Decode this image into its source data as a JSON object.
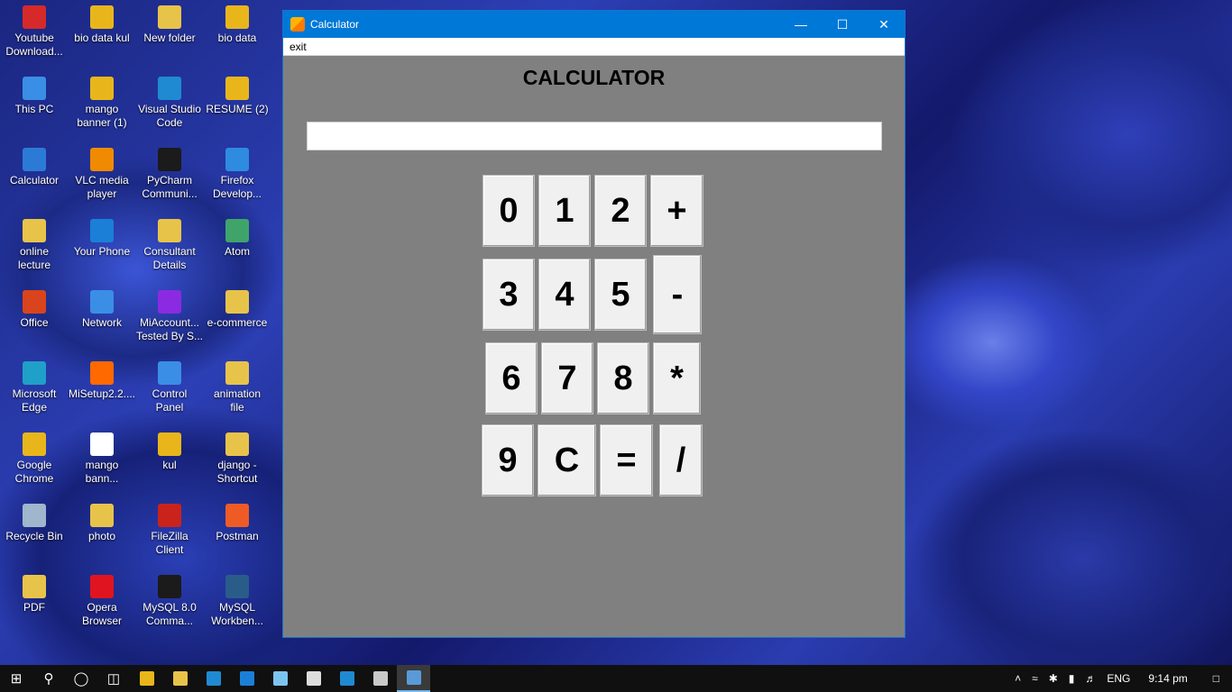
{
  "desktop_icons": [
    {
      "label": "Youtube\nDownload...",
      "icon": "youtube-downloader-icon",
      "color": "#d62a2a"
    },
    {
      "label": "bio data kul",
      "icon": "chrome-icon",
      "color": "#e8b61b"
    },
    {
      "label": "New folder",
      "icon": "folder-icon",
      "color": "#e8c34a"
    },
    {
      "label": "bio data",
      "icon": "chrome-icon",
      "color": "#e8b61b"
    },
    {
      "label": "This PC",
      "icon": "computer-icon",
      "color": "#3a8ee6"
    },
    {
      "label": "mango\nbanner (1)",
      "icon": "chrome-icon",
      "color": "#e8b61b"
    },
    {
      "label": "Visual Studio\nCode",
      "icon": "vscode-icon",
      "color": "#1f8ad2"
    },
    {
      "label": "RESUME (2)",
      "icon": "chrome-icon",
      "color": "#e8b61b"
    },
    {
      "label": "Calculator",
      "icon": "calculator-icon",
      "color": "#2b7bd6"
    },
    {
      "label": "VLC media\nplayer",
      "icon": "vlc-icon",
      "color": "#f08a00"
    },
    {
      "label": "PyCharm\nCommuni...",
      "icon": "pycharm-icon",
      "color": "#1b1b1b"
    },
    {
      "label": "Firefox\nDevelop...",
      "icon": "firefox-icon",
      "color": "#2e8be0"
    },
    {
      "label": "online\nlecture",
      "icon": "folder-icon",
      "color": "#e8c34a"
    },
    {
      "label": "Your Phone",
      "icon": "phone-icon",
      "color": "#1b7fd8"
    },
    {
      "label": "Consultant\nDetails",
      "icon": "folder-icon",
      "color": "#e8c34a"
    },
    {
      "label": "Atom",
      "icon": "atom-icon",
      "color": "#3fa46a"
    },
    {
      "label": "Office",
      "icon": "office-icon",
      "color": "#d9441c"
    },
    {
      "label": "Network",
      "icon": "network-icon",
      "color": "#3a8ee6"
    },
    {
      "label": "MiAccount...\nTested By S...",
      "icon": "winrar-icon",
      "color": "#8a2be2"
    },
    {
      "label": "e-commerce",
      "icon": "folder-icon",
      "color": "#e8c34a"
    },
    {
      "label": "Microsoft\nEdge",
      "icon": "edge-icon",
      "color": "#1fa0c8"
    },
    {
      "label": "MiSetup2.2....",
      "icon": "mi-icon",
      "color": "#ff6900"
    },
    {
      "label": "Control\nPanel",
      "icon": "control-panel-icon",
      "color": "#3a8ee6"
    },
    {
      "label": "animation\nfile",
      "icon": "folder-icon",
      "color": "#e8c34a"
    },
    {
      "label": "Google\nChrome",
      "icon": "chrome-icon",
      "color": "#e8b61b"
    },
    {
      "label": "mango\nbann...",
      "icon": "document-icon",
      "color": "#ffffff"
    },
    {
      "label": "kul",
      "icon": "chrome-icon",
      "color": "#e8b61b"
    },
    {
      "label": "django -\nShortcut",
      "icon": "shortcut-icon",
      "color": "#e8c34a"
    },
    {
      "label": "Recycle Bin",
      "icon": "recycle-bin-icon",
      "color": "#9fb6cc"
    },
    {
      "label": "photo",
      "icon": "folder-icon",
      "color": "#e8c34a"
    },
    {
      "label": "FileZilla\nClient",
      "icon": "filezilla-icon",
      "color": "#c9231c"
    },
    {
      "label": "Postman",
      "icon": "postman-icon",
      "color": "#ef5b25"
    },
    {
      "label": "PDF",
      "icon": "pdf-icon",
      "color": "#e8c34a"
    },
    {
      "label": "Opera\nBrowser",
      "icon": "opera-icon",
      "color": "#e0141e"
    },
    {
      "label": "MySQL 8.0\nComma...",
      "icon": "mysql-icon",
      "color": "#1b1b1b"
    },
    {
      "label": "MySQL\nWorkben...",
      "icon": "mysql-workbench-icon",
      "color": "#2a5c8a"
    }
  ],
  "window": {
    "title": "Calculator",
    "menu": {
      "exit": "exit"
    },
    "heading": "CALCULATOR",
    "display_value": "",
    "keys": [
      "0",
      "1",
      "2",
      "+",
      "3",
      "4",
      "5",
      "-",
      "6",
      "7",
      "8",
      "*",
      "9",
      "C",
      "=",
      "/"
    ]
  },
  "taskbar": {
    "apps": [
      {
        "icon": "chrome-icon",
        "color": "#e8b61b"
      },
      {
        "icon": "file-explorer-icon",
        "color": "#e8c34a"
      },
      {
        "icon": "store-icon",
        "color": "#1f8ad2"
      },
      {
        "icon": "phone-icon",
        "color": "#1b7fd8"
      },
      {
        "icon": "notepad-icon",
        "color": "#7cc4f0"
      },
      {
        "icon": "pycharm-icon",
        "color": "#dddddd"
      },
      {
        "icon": "vscode-icon",
        "color": "#1f8ad2"
      },
      {
        "icon": "python-idle-icon",
        "color": "#c9c9c9"
      },
      {
        "icon": "python-tk-icon",
        "color": "#5a9ad8"
      }
    ],
    "language": "ENG",
    "time": "9:14 pm"
  }
}
